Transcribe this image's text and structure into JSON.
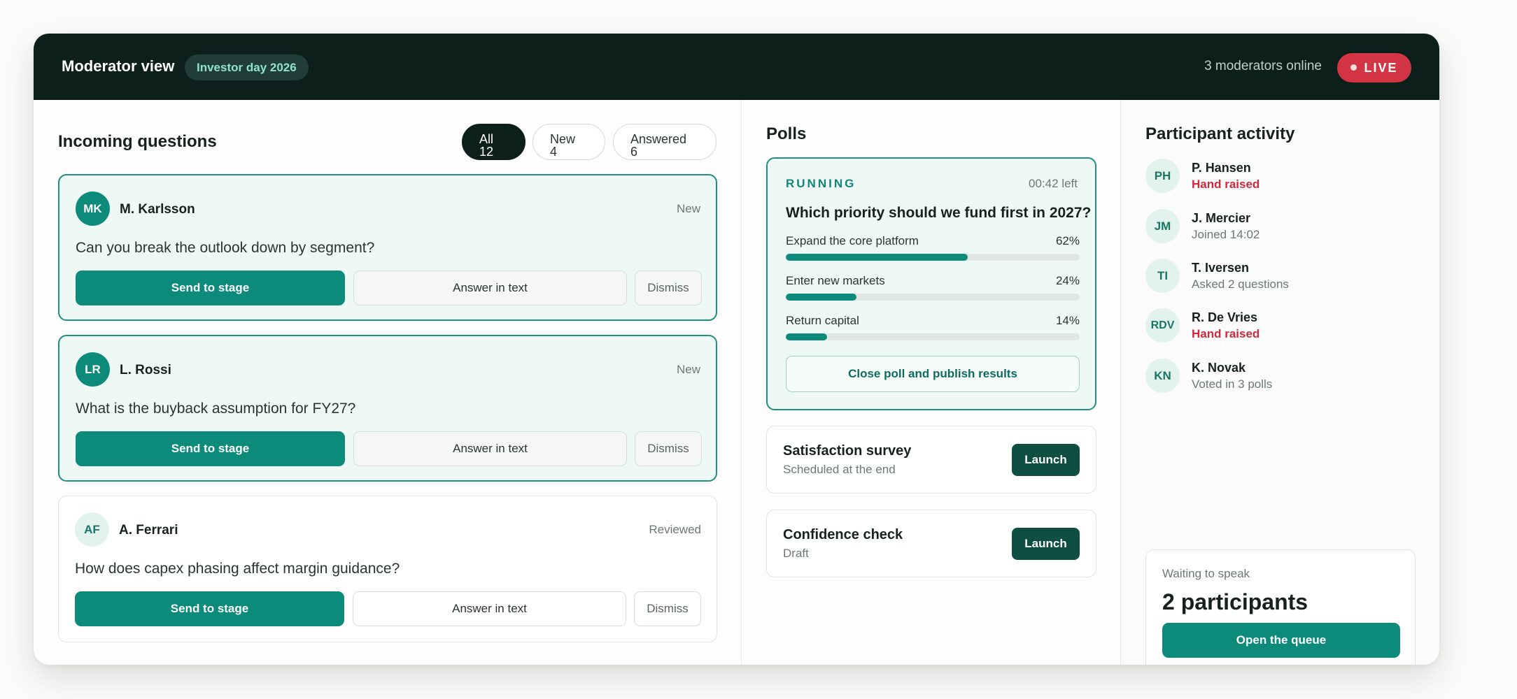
{
  "header": {
    "title": "Moderator view",
    "event": "Investor day 2026",
    "moderators_online": "3 moderators online",
    "live": "LIVE"
  },
  "questions": {
    "title": "Incoming questions",
    "filters": [
      {
        "label": "All",
        "count": "12",
        "active": true
      },
      {
        "label": "New",
        "count": "4",
        "active": false
      },
      {
        "label": "Answered",
        "count": "6",
        "active": false
      }
    ],
    "items": [
      {
        "initials": "MK",
        "name": "M. Karlsson",
        "status": "New",
        "text": "Can you break the outlook down by segment?",
        "send": "Send to stage",
        "answer": "Answer in text",
        "dismiss": "Dismiss"
      },
      {
        "initials": "LR",
        "name": "L. Rossi",
        "status": "New",
        "text": "What is the buyback assumption for FY27?",
        "send": "Send to stage",
        "answer": "Answer in text",
        "dismiss": "Dismiss"
      },
      {
        "initials": "AF",
        "name": "A. Ferrari",
        "status": "Reviewed",
        "text": "How does capex phasing affect margin guidance?",
        "send": "Send to stage",
        "answer": "Answer in text",
        "dismiss": "Dismiss"
      }
    ]
  },
  "polls": {
    "title": "Polls",
    "running": {
      "status": "RUNNING",
      "time_left": "00:42 left",
      "question": "Which priority should we fund first in 2027?",
      "options": [
        {
          "label": "Expand the core platform",
          "percent": "62%",
          "value": 62
        },
        {
          "label": "Enter new markets",
          "percent": "24%",
          "value": 24
        },
        {
          "label": "Return capital",
          "percent": "14%",
          "value": 14
        }
      ],
      "close_label": "Close poll and publish results"
    },
    "queued": [
      {
        "title": "Satisfaction survey",
        "subtitle": "Scheduled at the end",
        "action": "Launch"
      },
      {
        "title": "Confidence check",
        "subtitle": "Draft",
        "action": "Launch"
      }
    ]
  },
  "activity": {
    "title": "Participant activity",
    "participants": [
      {
        "initials": "PH",
        "name": "P. Hansen",
        "status": "Hand raised",
        "alert": true
      },
      {
        "initials": "JM",
        "name": "J. Mercier",
        "status": "Joined 14:02",
        "alert": false
      },
      {
        "initials": "TI",
        "name": "T. Iversen",
        "status": "Asked 2 questions",
        "alert": false
      },
      {
        "initials": "RDV",
        "name": "R. De Vries",
        "status": "Hand raised",
        "alert": true
      },
      {
        "initials": "KN",
        "name": "K. Novak",
        "status": "Voted in 3 polls",
        "alert": false
      }
    ],
    "waiting": {
      "label": "Waiting to speak",
      "count": "2 participants",
      "action": "Open the queue"
    }
  }
}
